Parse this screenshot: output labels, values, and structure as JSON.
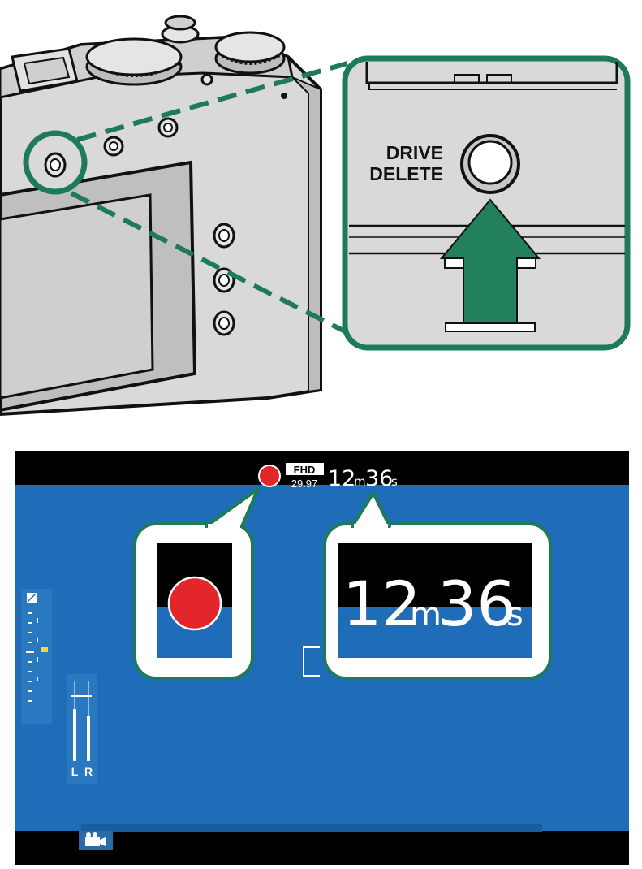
{
  "camera": {
    "button_label_line1": "DRIVE",
    "button_label_line2": "DELETE"
  },
  "monitor": {
    "format_badge": "FHD",
    "frame_rate": "29.97",
    "time_remaining": {
      "minutes": "12",
      "minutes_unit": "m",
      "seconds": "36",
      "seconds_unit": "s"
    },
    "audio_channels": {
      "left": "L",
      "right": "R"
    },
    "colors": {
      "screen_blue": "#1f6db8",
      "record_red": "#e3262b",
      "callout_green": "#1f7a5a",
      "arrow_green": "#23805d",
      "camera_gray": "#d9d9d9"
    },
    "icons": [
      "record-indicator-icon",
      "exposure-compensation-icon",
      "movie-mode-icon"
    ]
  }
}
